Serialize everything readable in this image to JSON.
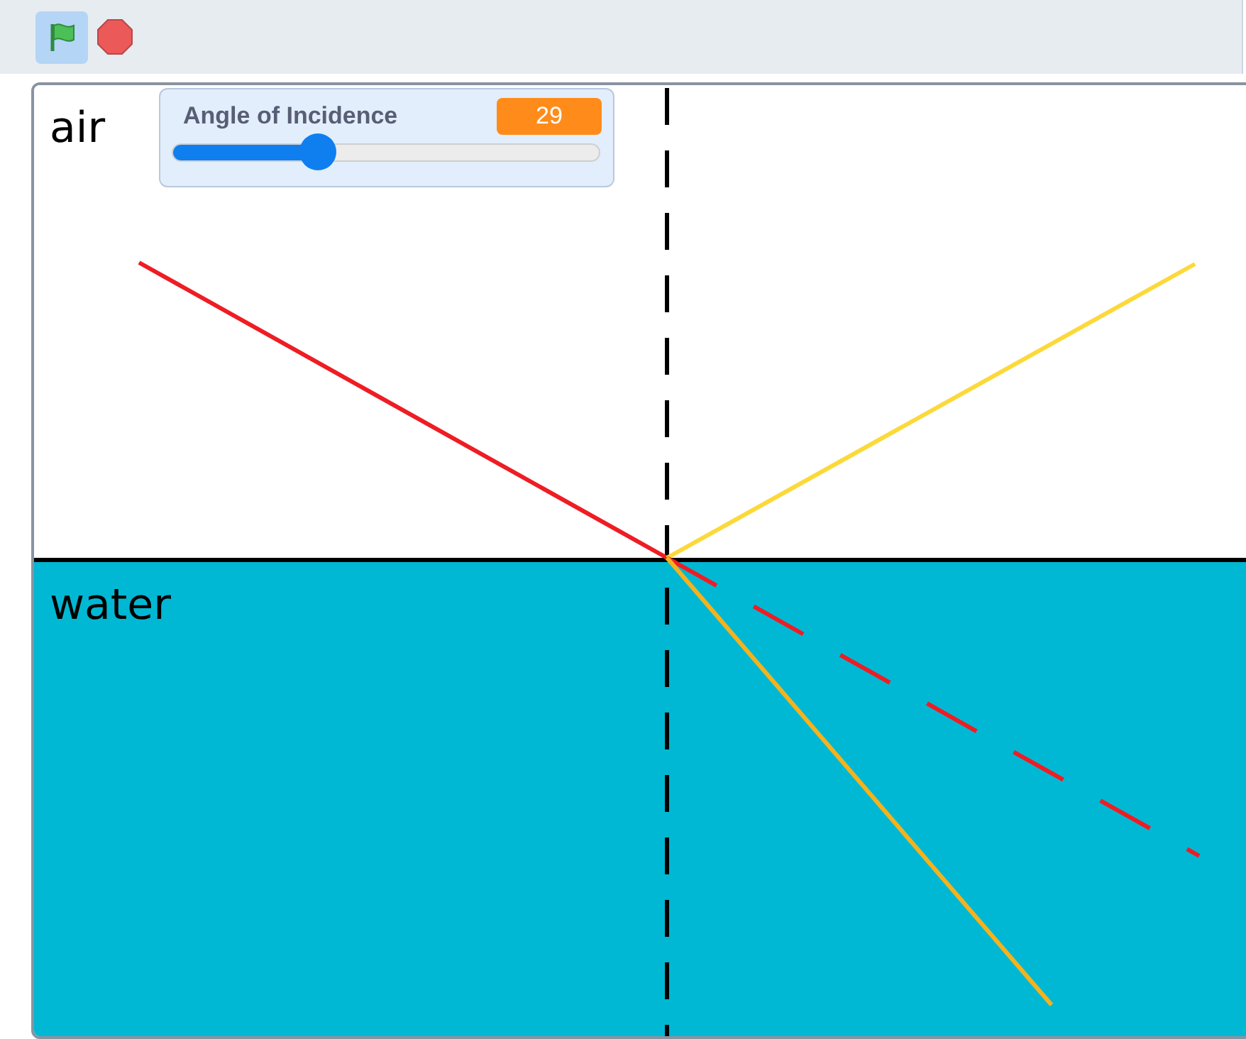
{
  "toolbar": {
    "green_flag": {
      "active": true
    }
  },
  "stage": {
    "regions": [
      {
        "label": "air",
        "kind": "air"
      },
      {
        "label": "water",
        "kind": "water"
      }
    ],
    "monitor": {
      "label": "Angle of Incidence",
      "value": "29",
      "level": 0.34
    }
  }
}
